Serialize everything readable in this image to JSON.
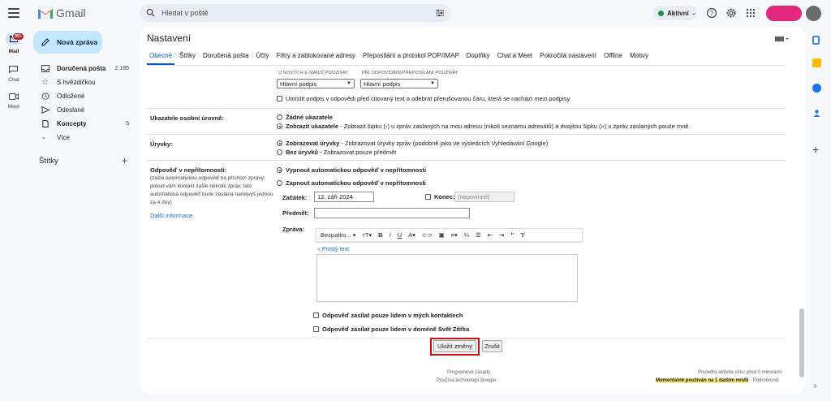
{
  "app": {
    "name": "Gmail"
  },
  "search": {
    "placeholder": "Hledat v poště"
  },
  "status": {
    "label": "Aktivní"
  },
  "rail": {
    "mail_badge": "99+",
    "mail": "Mail",
    "chat": "Chat",
    "meet": "Meet"
  },
  "compose": {
    "label": "Nová zpráva"
  },
  "nav": [
    {
      "label": "Doručená pošta",
      "count": "2 185",
      "bold": true
    },
    {
      "label": "S hvězdičkou",
      "count": ""
    },
    {
      "label": "Odložené",
      "count": ""
    },
    {
      "label": "Odeslané",
      "count": ""
    },
    {
      "label": "Koncepty",
      "count": "5",
      "bold": true
    },
    {
      "label": "Více",
      "count": ""
    }
  ],
  "labels_header": "Štítky",
  "settings": {
    "title": "Nastavení",
    "tabs": [
      "Obecné",
      "Štítky",
      "Doručená pošta",
      "Účty",
      "Filtry a zablokované adresy",
      "Přeposílání a protokol POP/IMAP",
      "Doplňky",
      "Chat a Meet",
      "Pokročilá nastavení",
      "Offline",
      "Motivy"
    ],
    "signature": {
      "new_caption": "U NOVÝCH E-MAILŮ POUŽÍVAT",
      "reply_caption": "PŘI ODPOVÍDÁNÍ/PŘEPOSÍLÁNÍ POUŽÍVAT",
      "new_value": "Hlavní podpis",
      "reply_value": "Hlavní podpis",
      "place_above": "Umístit podpis v odpovědi před citovaný text a odebrat přerušovanou čáru, která se nachází mezi podpisy."
    },
    "indicators": {
      "label": "Ukazatele osobní úrovně:",
      "opt1": "Žádné ukazatele",
      "opt2_bold": "Zobrazit ukazatele",
      "opt2_rest": " - Zobrazit šipku (›) u zpráv zaslaných na mou adresu (nikoli seznamu adresátů) a dvojitou šipku (») u zpráv zaslaných pouze mně."
    },
    "snippets": {
      "label": "Úryvky:",
      "opt1_bold": "Zobrazovat úryvky",
      "opt1_rest": " - Zobrazovat úryvky zpráv (podobně jako ve výsledcích Vyhledávání Google)",
      "opt2_bold": "Bez úryvků",
      "opt2_rest": " - Zobrazovat pouze předmět"
    },
    "vacation": {
      "label": "Odpověď v nepřítomnosti:",
      "desc": [
        "(zašle automatickou odpověď na příchozí zprávy;",
        "pokud vám kontakt zašle několik zpráv, tato",
        "automatická odpověď bude zaslána nanejvýš jednou",
        "za 4 dny)"
      ],
      "more": "Další informace",
      "off": "Vypnout automatickou odpověď v nepřítomnosti",
      "on": "Zapnout automatickou odpověď v nepřítomnosti",
      "start_label": "Začátek:",
      "start_value": "12. září 2024",
      "end_label": "Konec:",
      "end_placeholder": "(nepovinné)",
      "subject_label": "Předmět:",
      "message_label": "Zpráva:",
      "font": "Bezpatko...",
      "plain_text": "« Prostý text",
      "contacts_only": "Odpověď zasílat pouze lidem v mých kontaktech",
      "domain_only": "Odpověď zasílat pouze lidem v doméně Svět Zítřka"
    },
    "save": "Uložit změny",
    "cancel": "Zrušit"
  },
  "footer": {
    "policies": "Programové zásady",
    "powered": "Používá technologii Google",
    "last_activity": "Poslední aktivita účtu: před 0 minutami",
    "in_use": "Momentálně používán na 1 dalším místě",
    "details": " · Podrobnosti"
  },
  "colors": {
    "accent": "#0b57d0",
    "compose": "#c2e7ff",
    "highlight": "#d01010"
  }
}
